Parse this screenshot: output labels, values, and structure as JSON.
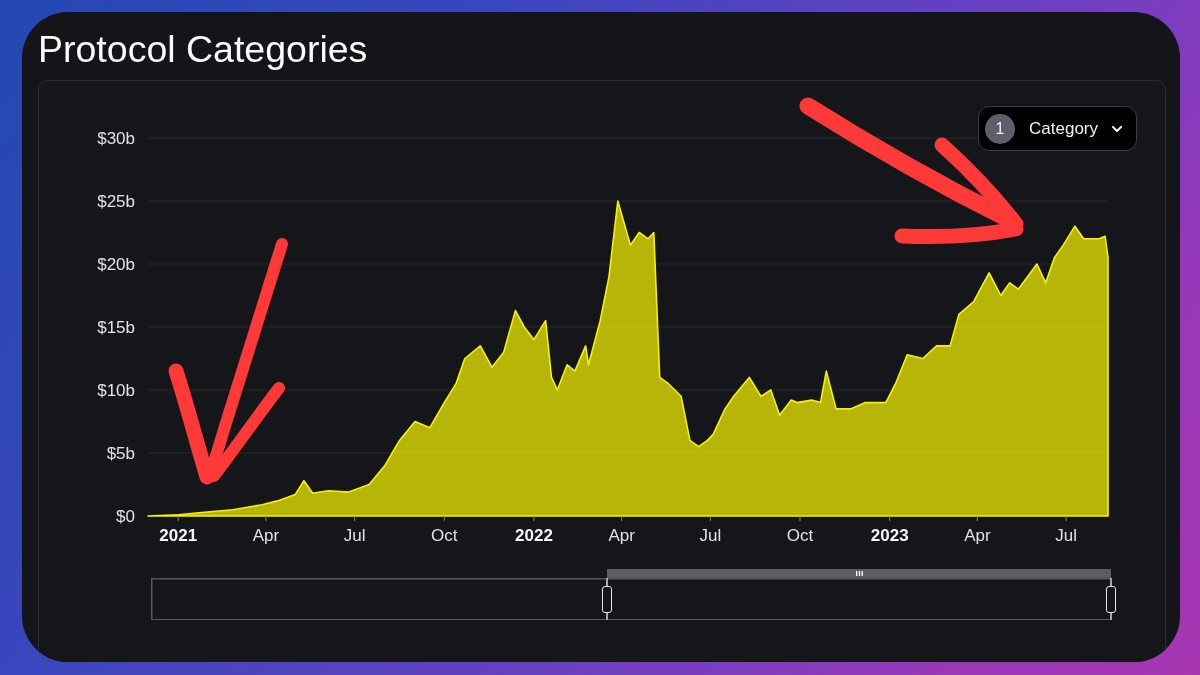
{
  "title": "Protocol Categories",
  "category_filter": {
    "count": "1",
    "label": "Category"
  },
  "chart": {
    "chart_data": {
      "type": "area",
      "grid": true,
      "x": [
        "2020-12-01",
        "2021-01-01",
        "2021-01-28",
        "2021-02-26",
        "2021-03-28",
        "2021-04-13",
        "2021-05-01",
        "2021-05-10",
        "2021-05-19",
        "2021-06-04",
        "2021-06-25",
        "2021-07-16",
        "2021-08-01",
        "2021-08-16",
        "2021-09-01",
        "2021-09-16",
        "2021-10-01",
        "2021-10-13",
        "2021-10-22",
        "2021-11-07",
        "2021-11-19",
        "2021-12-01",
        "2021-12-13",
        "2021-12-22",
        "2022-01-01",
        "2022-01-13",
        "2022-01-19",
        "2022-01-25",
        "2022-02-04",
        "2022-02-12",
        "2022-02-23",
        "2022-02-26",
        "2022-03-10",
        "2022-03-19",
        "2022-03-28",
        "2022-04-10",
        "2022-04-19",
        "2022-04-28",
        "2022-05-04",
        "2022-05-10",
        "2022-05-19",
        "2022-06-01",
        "2022-06-10",
        "2022-06-19",
        "2022-06-28",
        "2022-07-04",
        "2022-07-16",
        "2022-07-25",
        "2022-08-10",
        "2022-08-22",
        "2022-09-01",
        "2022-09-10",
        "2022-09-22",
        "2022-09-28",
        "2022-10-13",
        "2022-10-22",
        "2022-10-28",
        "2022-11-07",
        "2022-11-22",
        "2022-12-07",
        "2022-12-28",
        "2023-01-07",
        "2023-01-19",
        "2023-02-04",
        "2023-02-18",
        "2023-03-04",
        "2023-03-13",
        "2023-03-28",
        "2023-04-13",
        "2023-04-25",
        "2023-05-04",
        "2023-05-13",
        "2023-06-01",
        "2023-06-10",
        "2023-06-19",
        "2023-06-28",
        "2023-07-10",
        "2023-07-19",
        "2023-08-04",
        "2023-08-10",
        "2023-08-13"
      ],
      "series": [
        {
          "color": "#f7f200",
          "values": [
            0,
            0.1,
            0.3,
            0.5,
            0.9,
            1.2,
            1.7,
            2.8,
            1.8,
            2.0,
            1.9,
            2.5,
            4.0,
            6.0,
            7.5,
            7.0,
            9.0,
            10.5,
            12.5,
            13.5,
            11.8,
            13.0,
            16.3,
            15.0,
            14.0,
            15.5,
            11.0,
            10.0,
            12.0,
            11.5,
            13.5,
            12.0,
            15.5,
            19.0,
            25.0,
            21.5,
            22.5,
            22.0,
            22.5,
            11.0,
            10.5,
            9.5,
            6.0,
            5.5,
            6.0,
            6.5,
            8.5,
            9.5,
            11.0,
            9.5,
            10.0,
            8.0,
            9.2,
            9.0,
            9.2,
            9.0,
            11.5,
            8.5,
            8.5,
            9.0,
            9.0,
            10.5,
            12.8,
            12.5,
            13.5,
            13.5,
            16.0,
            17.0,
            19.3,
            17.5,
            18.5,
            18.0,
            20.0,
            18.5,
            20.5,
            21.5,
            23.0,
            22.0,
            22.0,
            22.2,
            20.5
          ]
        }
      ],
      "xlim": [
        "2020-12-01",
        "2023-08-13"
      ],
      "ylim": [
        0,
        30
      ],
      "xticks": [
        {
          "value": "2021-01-01",
          "label": "2021"
        },
        {
          "value": "2021-04-01",
          "label": "Apr"
        },
        {
          "value": "2021-07-01",
          "label": "Jul"
        },
        {
          "value": "2021-10-01",
          "label": "Oct"
        },
        {
          "value": "2022-01-01",
          "label": "2022"
        },
        {
          "value": "2022-04-01",
          "label": "Apr"
        },
        {
          "value": "2022-07-01",
          "label": "Jul"
        },
        {
          "value": "2022-10-01",
          "label": "Oct"
        },
        {
          "value": "2023-01-01",
          "label": "2023"
        },
        {
          "value": "2023-04-01",
          "label": "Apr"
        },
        {
          "value": "2023-07-01",
          "label": "Jul"
        }
      ],
      "yticks": [
        {
          "value": 0,
          "label": "$0"
        },
        {
          "value": 5,
          "label": "$5b"
        },
        {
          "value": 10,
          "label": "$10b"
        },
        {
          "value": 15,
          "label": "$15b"
        },
        {
          "value": 20,
          "label": "$20b"
        },
        {
          "value": 25,
          "label": "$25b"
        },
        {
          "value": 30,
          "label": "$30b"
        }
      ]
    }
  },
  "range_slider": {
    "level": 0.525
  }
}
